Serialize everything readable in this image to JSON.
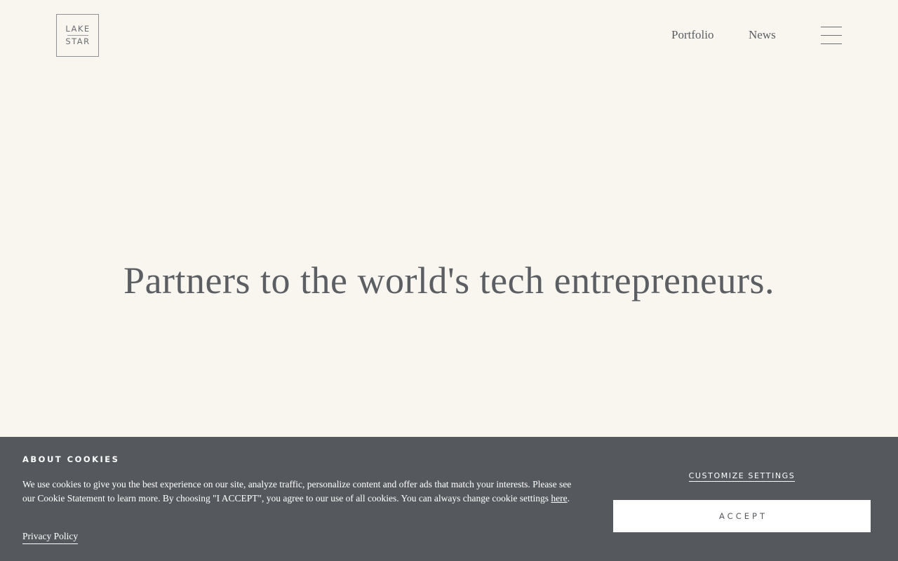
{
  "header": {
    "logo": {
      "line1": "LAKE",
      "line2": "STAR"
    },
    "nav": [
      {
        "label": "Portfolio"
      },
      {
        "label": "News"
      }
    ],
    "menu_icon": "hamburger-icon"
  },
  "hero": {
    "title": "Partners to the world's tech entrepreneurs."
  },
  "cookie_banner": {
    "heading": "ABOUT COOKIES",
    "text_main": "We use cookies to give you the best experience on our site, analyze traffic, personalize content and offer ads that match your interests. Please see our Cookie Statement to learn more. By choosing \"I ACCEPT\", you agree to our use of all cookies. You can always change cookie settings ",
    "text_link": "here",
    "text_end": ".",
    "privacy_link": "Privacy Policy",
    "customize_label": "CUSTOMIZE SETTINGS",
    "accept_label": "ACCEPT"
  },
  "colors": {
    "page_background": "#f8f6ef",
    "text": "#5b5e62",
    "banner_background": "#55585c",
    "banner_text": "#ffffff"
  }
}
